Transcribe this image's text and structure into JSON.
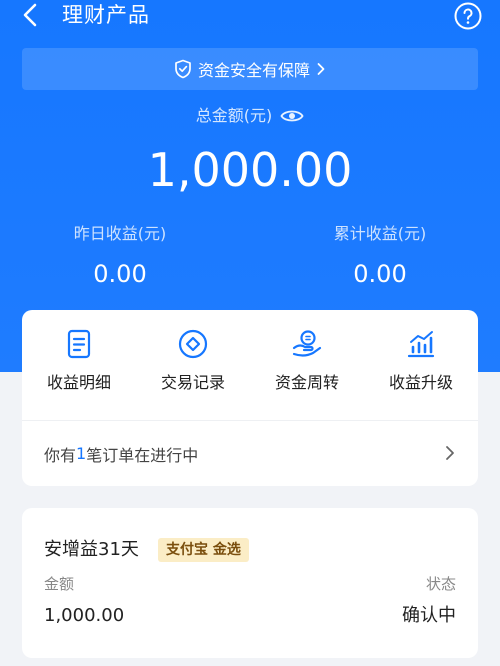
{
  "header": {
    "title": "理财产品",
    "back_icon": "chevron-left-icon",
    "help_icon": "question-circle-icon"
  },
  "banner": {
    "text": "资金安全有保障",
    "icon": "shield-check-icon"
  },
  "summary": {
    "total_label": "总金额(元)",
    "total_value": "1,000.00",
    "yesterday_label": "昨日收益(元)",
    "yesterday_value": "0.00",
    "cumulative_label": "累计收益(元)",
    "cumulative_value": "0.00"
  },
  "actions": [
    {
      "label": "收益明细",
      "icon": "document-list-icon"
    },
    {
      "label": "交易记录",
      "icon": "diamond-circle-icon"
    },
    {
      "label": "资金周转",
      "icon": "hand-coin-icon"
    },
    {
      "label": "收益升级",
      "icon": "bar-chart-icon"
    }
  ],
  "pending": {
    "prefix": "你有",
    "count": "1",
    "suffix": "笔订单在进行中"
  },
  "product": {
    "name": "安增益31天",
    "badge": "支付宝 金选",
    "amount_label": "金额",
    "amount_value": "1,000.00",
    "status_label": "状态",
    "status_value": "确认中"
  },
  "colors": {
    "primary": "#1677ff",
    "badge_bg": "#fbedc6",
    "badge_text": "#7a4e0d"
  }
}
